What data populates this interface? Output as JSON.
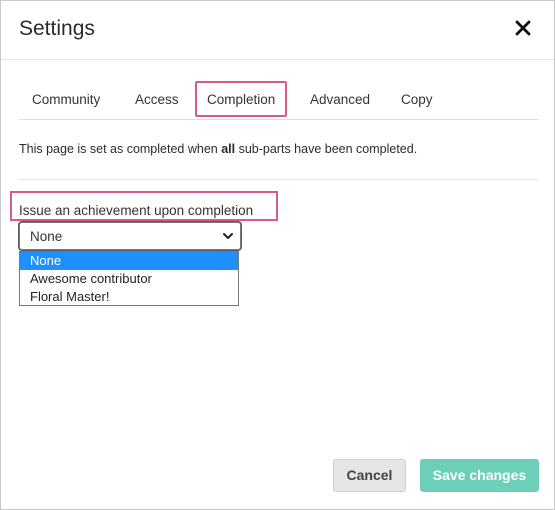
{
  "dialog": {
    "title": "Settings",
    "close_icon": "close-icon"
  },
  "tabs": [
    {
      "label": "Community"
    },
    {
      "label": "Access"
    },
    {
      "label": "Completion",
      "active": true
    },
    {
      "label": "Advanced"
    },
    {
      "label": "Copy"
    }
  ],
  "completion": {
    "info_before": "This page is set as completed when ",
    "info_bold": "all",
    "info_after": " sub-parts have been completed.",
    "achievement_label": "Issue an achievement upon completion",
    "select_value": "None",
    "chevron_icon": "chevron-down-icon",
    "options": [
      "None",
      "Awesome contributor",
      "Floral Master!"
    ]
  },
  "footer": {
    "cancel_label": "Cancel",
    "save_label": "Save changes"
  },
  "colors": {
    "highlight_border": "#d9598c",
    "primary": "#6ccfb7",
    "option_selected": "#1e90ff"
  }
}
